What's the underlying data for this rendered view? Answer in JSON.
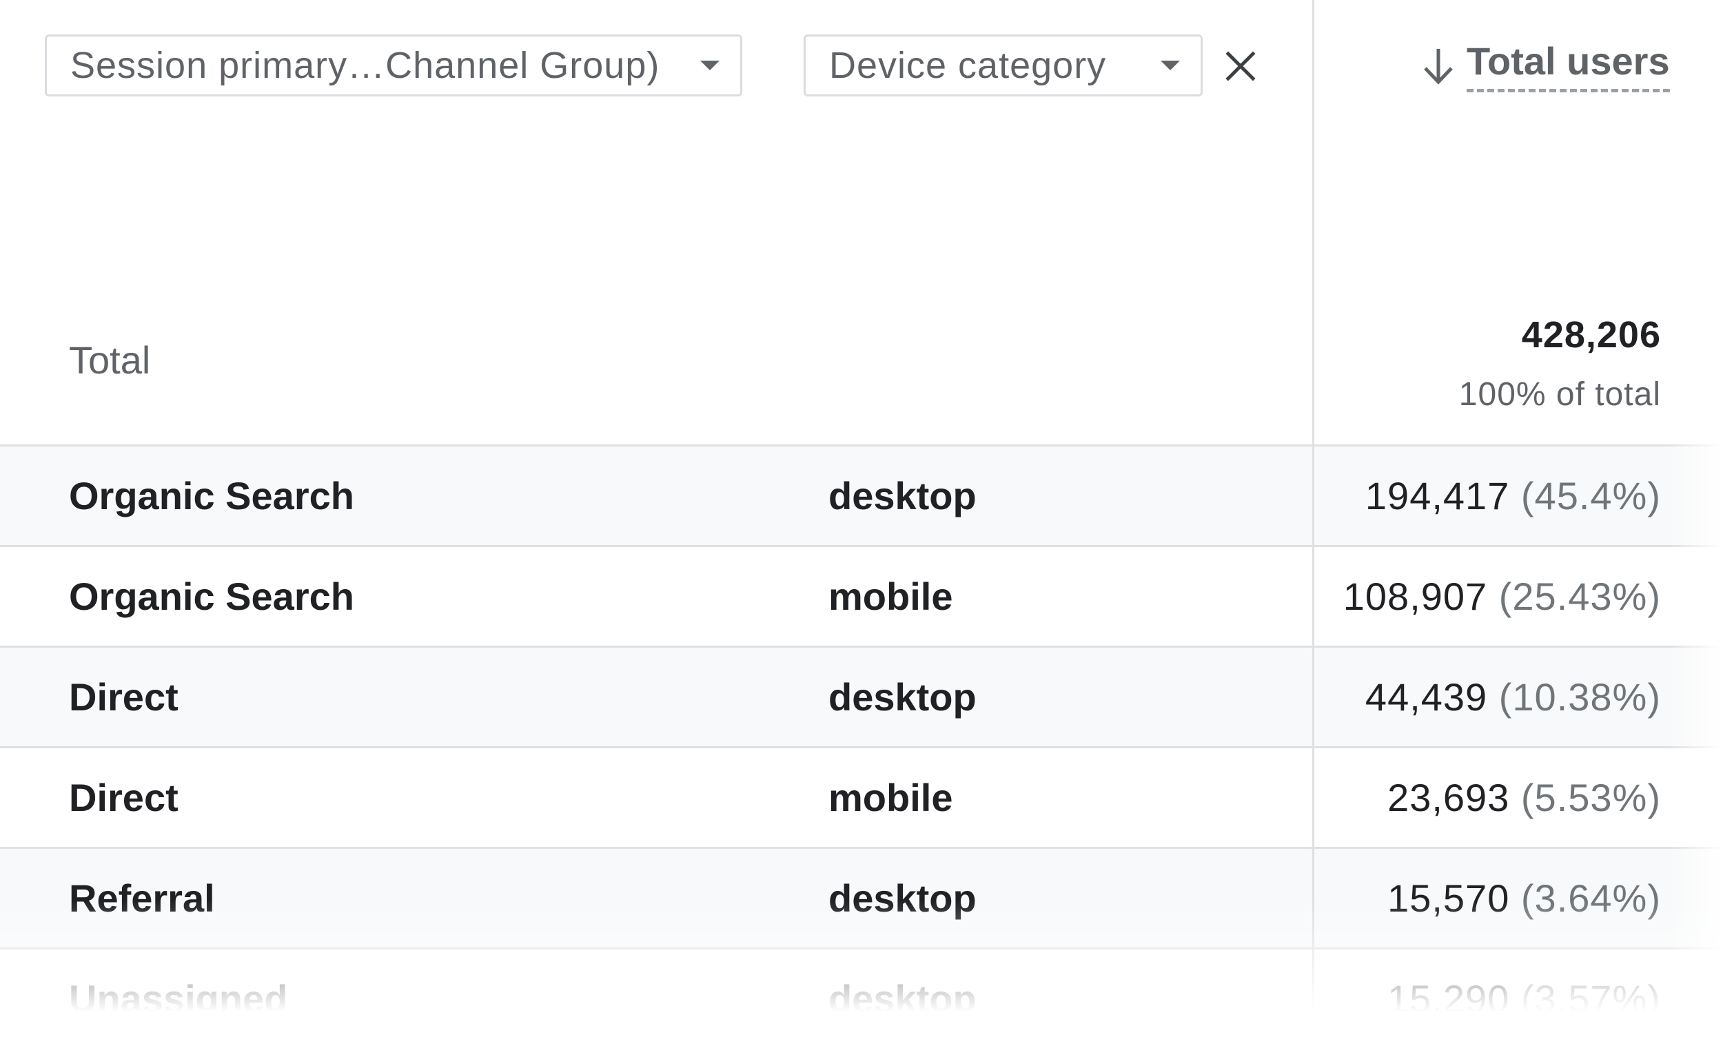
{
  "dimensions": {
    "primary": "Session primary…Channel Group)",
    "secondary": "Device category"
  },
  "metric": {
    "label": "Total users",
    "sort": "descending"
  },
  "totals": {
    "label": "Total",
    "value": "428,206",
    "subtext": "100% of total"
  },
  "rows": [
    {
      "channel": "Organic Search",
      "device": "desktop",
      "value": "194,417",
      "pct": "(45.4%)"
    },
    {
      "channel": "Organic Search",
      "device": "mobile",
      "value": "108,907",
      "pct": "(25.43%)"
    },
    {
      "channel": "Direct",
      "device": "desktop",
      "value": "44,439",
      "pct": "(10.38%)"
    },
    {
      "channel": "Direct",
      "device": "mobile",
      "value": "23,693",
      "pct": "(5.53%)"
    },
    {
      "channel": "Referral",
      "device": "desktop",
      "value": "15,570",
      "pct": "(3.64%)"
    },
    {
      "channel": "Unassigned",
      "device": "desktop",
      "value": "15,290",
      "pct": "(3.57%)"
    }
  ],
  "icons": {
    "dropdown": "arrow-drop-down-icon",
    "remove": "close-icon",
    "sort": "arrow-downward-icon"
  },
  "colors": {
    "text_primary": "#202124",
    "text_secondary": "#5f6368",
    "border": "#dadce0",
    "row_shade": "#f8f9fa"
  }
}
